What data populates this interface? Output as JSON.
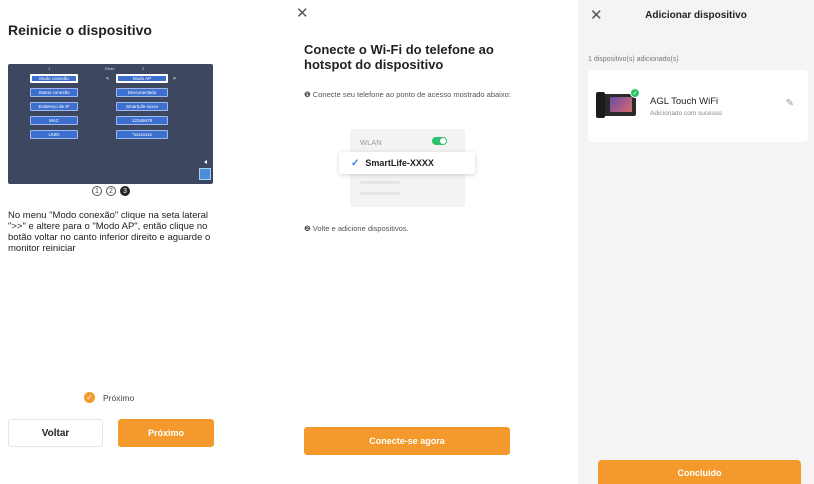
{
  "screen1": {
    "title": "Reinicie o dispositivo",
    "monitor": {
      "header_left": "1",
      "header_center": "Rede",
      "header_right": "2",
      "left_buttons": [
        "Modo conexão",
        "Status conexão",
        "Endereço de IP",
        "MAC",
        "UUID"
      ],
      "right_buttons": [
        "Modo AP",
        "Desconectado",
        "SmartLife-xxxxx",
        "12345678",
        "*xxxxxxxx"
      ],
      "arrow_left": "<",
      "arrow_right": ">"
    },
    "steps": [
      "1",
      "2",
      "3"
    ],
    "instruction": "No menu \"Modo conexão\" clique na seta lateral \">>\" e altere para o \"Modo AP\", então clique no botão voltar no canto inferior direito e aguarde o monitor reiniciar",
    "checkbox_label": "Próximo",
    "back_label": "Voltar",
    "next_label": "Próximo"
  },
  "screen2": {
    "title": "Conecte o Wi-Fi do telefone ao hotspot do dispositivo",
    "step1": "❶ Conecte seu telefone ao ponto de acesso mostrado abaixo:",
    "wlan_label": "WLAN",
    "ssid": "SmartLife-XXXX",
    "step2": "❷ Volte e adicione dispositivos.",
    "connect_label": "Conecte-se agora"
  },
  "screen3": {
    "title": "Adicionar dispositivo",
    "count_text": "1 dispositivo(s) adicionado(s)",
    "device_name": "AGL Touch WiFi",
    "device_status": "Adicionado com sucesso",
    "done_label": "Concluído"
  },
  "colors": {
    "accent": "#f49a2c",
    "success": "#2cc36b",
    "monitor_bg": "#3d4760",
    "monitor_button": "#3d6fcf"
  },
  "icons": [
    "close-icon",
    "check-icon",
    "pencil-icon",
    "toggle-on-icon"
  ]
}
